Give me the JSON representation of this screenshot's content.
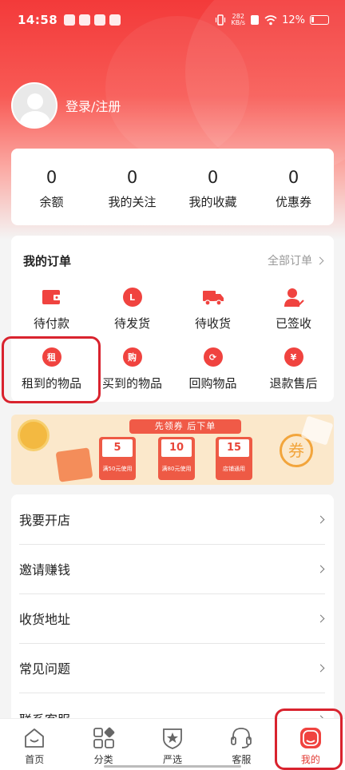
{
  "status_bar": {
    "time": "14:58",
    "speed_value": "282",
    "speed_unit": "KB/s",
    "battery": "12%"
  },
  "profile": {
    "login_label": "登录/注册"
  },
  "stats": [
    {
      "value": "0",
      "label": "余额"
    },
    {
      "value": "0",
      "label": "我的关注"
    },
    {
      "value": "0",
      "label": "我的收藏"
    },
    {
      "value": "0",
      "label": "优惠券"
    }
  ],
  "orders": {
    "title": "我的订单",
    "all_label": "全部订单",
    "items": [
      {
        "label": "待付款",
        "icon": "wallet-icon"
      },
      {
        "label": "待发货",
        "icon": "clock-icon"
      },
      {
        "label": "待收货",
        "icon": "truck-icon"
      },
      {
        "label": "已签收",
        "icon": "user-check-icon"
      },
      {
        "label": "租到的物品",
        "icon": "rent-icon",
        "glyph": "租"
      },
      {
        "label": "买到的物品",
        "icon": "buy-icon",
        "glyph": "购"
      },
      {
        "label": "回购物品",
        "icon": "refresh-icon",
        "glyph": "⟳"
      },
      {
        "label": "退款售后",
        "icon": "yen-icon",
        "glyph": "¥"
      }
    ]
  },
  "banner": {
    "headline": "先领券  后下单",
    "coupons": [
      {
        "value": "5",
        "condition": "满50元使用"
      },
      {
        "value": "10",
        "condition": "满80元使用"
      },
      {
        "value": "15",
        "condition": "店铺通用"
      }
    ],
    "badge": "券"
  },
  "menu": [
    {
      "label": "我要开店"
    },
    {
      "label": "邀请赚钱"
    },
    {
      "label": "收货地址"
    },
    {
      "label": "常见问题"
    },
    {
      "label": "联系客服"
    }
  ],
  "tabbar": [
    {
      "label": "首页",
      "icon": "home-icon"
    },
    {
      "label": "分类",
      "icon": "category-icon"
    },
    {
      "label": "严选",
      "icon": "star-shield-icon"
    },
    {
      "label": "客服",
      "icon": "headset-icon"
    },
    {
      "label": "我的",
      "icon": "profile-icon",
      "active": true
    }
  ],
  "colors": {
    "brand_red": "#f33a3a",
    "highlight_border": "#d9232e"
  }
}
